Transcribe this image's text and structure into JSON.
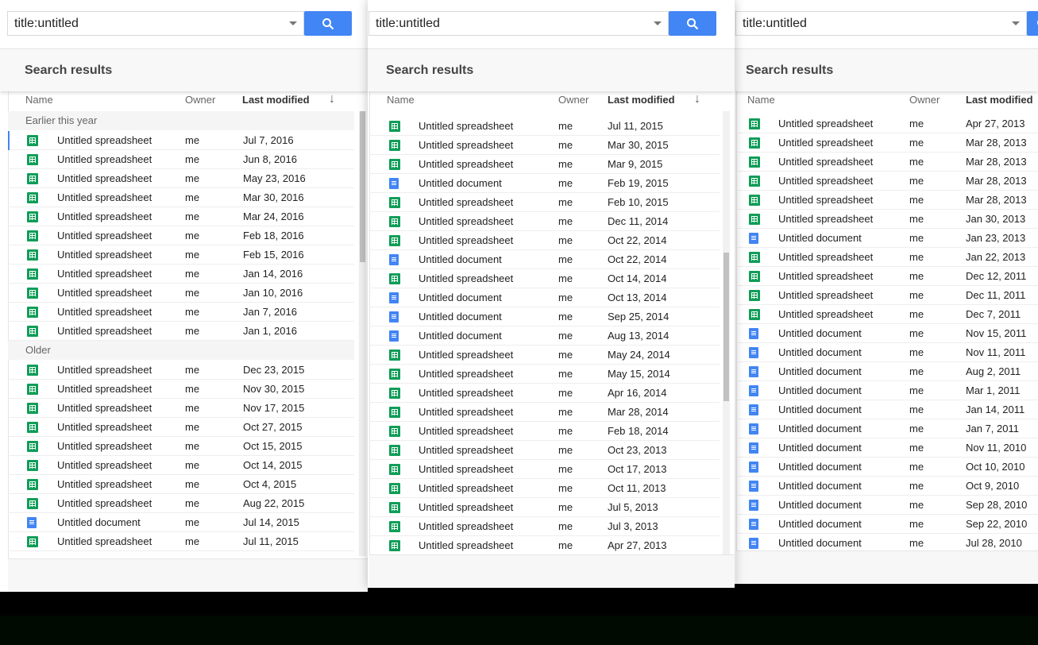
{
  "search": {
    "query": "title:untitled"
  },
  "header": {
    "title": "Search results"
  },
  "columns": {
    "name": "Name",
    "owner": "Owner",
    "modified": "Last modified",
    "sort_icon": "arrow-down-icon"
  },
  "colors": {
    "accent": "#4285f4",
    "sheet": "#0f9d58",
    "doc": "#4285f4"
  },
  "panels": [
    {
      "groups": [
        {
          "label": "Earlier this year",
          "rows": [
            {
              "t": "s",
              "name": "Untitled spreadsheet",
              "owner": "me",
              "date": "Jul 7, 2016"
            },
            {
              "t": "s",
              "name": "Untitled spreadsheet",
              "owner": "me",
              "date": "Jun 8, 2016"
            },
            {
              "t": "s",
              "name": "Untitled spreadsheet",
              "owner": "me",
              "date": "May 23, 2016"
            },
            {
              "t": "s",
              "name": "Untitled spreadsheet",
              "owner": "me",
              "date": "Mar 30, 2016"
            },
            {
              "t": "s",
              "name": "Untitled spreadsheet",
              "owner": "me",
              "date": "Mar 24, 2016"
            },
            {
              "t": "s",
              "name": "Untitled spreadsheet",
              "owner": "me",
              "date": "Feb 18, 2016"
            },
            {
              "t": "s",
              "name": "Untitled spreadsheet",
              "owner": "me",
              "date": "Feb 15, 2016"
            },
            {
              "t": "s",
              "name": "Untitled spreadsheet",
              "owner": "me",
              "date": "Jan 14, 2016"
            },
            {
              "t": "s",
              "name": "Untitled spreadsheet",
              "owner": "me",
              "date": "Jan 10, 2016"
            },
            {
              "t": "s",
              "name": "Untitled spreadsheet",
              "owner": "me",
              "date": "Jan 7, 2016"
            },
            {
              "t": "s",
              "name": "Untitled spreadsheet",
              "owner": "me",
              "date": "Jan 1, 2016"
            }
          ]
        },
        {
          "label": "Older",
          "rows": [
            {
              "t": "s",
              "name": "Untitled spreadsheet",
              "owner": "me",
              "date": "Dec 23, 2015"
            },
            {
              "t": "s",
              "name": "Untitled spreadsheet",
              "owner": "me",
              "date": "Nov 30, 2015"
            },
            {
              "t": "s",
              "name": "Untitled spreadsheet",
              "owner": "me",
              "date": "Nov 17, 2015"
            },
            {
              "t": "s",
              "name": "Untitled spreadsheet",
              "owner": "me",
              "date": "Oct 27, 2015"
            },
            {
              "t": "s",
              "name": "Untitled spreadsheet",
              "owner": "me",
              "date": "Oct 15, 2015"
            },
            {
              "t": "s",
              "name": "Untitled spreadsheet",
              "owner": "me",
              "date": "Oct 14, 2015"
            },
            {
              "t": "s",
              "name": "Untitled spreadsheet",
              "owner": "me",
              "date": "Oct 4, 2015"
            },
            {
              "t": "s",
              "name": "Untitled spreadsheet",
              "owner": "me",
              "date": "Aug 22, 2015"
            },
            {
              "t": "d",
              "name": "Untitled document",
              "owner": "me",
              "date": "Jul 14, 2015"
            },
            {
              "t": "s",
              "name": "Untitled spreadsheet",
              "owner": "me",
              "date": "Jul 11, 2015"
            }
          ]
        }
      ]
    },
    {
      "groups": [
        {
          "label": null,
          "rows": [
            {
              "t": "s",
              "name": "Untitled spreadsheet",
              "owner": "me",
              "date": "Jul 11, 2015"
            },
            {
              "t": "s",
              "name": "Untitled spreadsheet",
              "owner": "me",
              "date": "Mar 30, 2015"
            },
            {
              "t": "s",
              "name": "Untitled spreadsheet",
              "owner": "me",
              "date": "Mar 9, 2015"
            },
            {
              "t": "d",
              "name": "Untitled document",
              "owner": "me",
              "date": "Feb 19, 2015"
            },
            {
              "t": "s",
              "name": "Untitled spreadsheet",
              "owner": "me",
              "date": "Feb 10, 2015"
            },
            {
              "t": "s",
              "name": "Untitled spreadsheet",
              "owner": "me",
              "date": "Dec 11, 2014"
            },
            {
              "t": "s",
              "name": "Untitled spreadsheet",
              "owner": "me",
              "date": "Oct 22, 2014"
            },
            {
              "t": "d",
              "name": "Untitled document",
              "owner": "me",
              "date": "Oct 22, 2014"
            },
            {
              "t": "s",
              "name": "Untitled spreadsheet",
              "owner": "me",
              "date": "Oct 14, 2014"
            },
            {
              "t": "d",
              "name": "Untitled document",
              "owner": "me",
              "date": "Oct 13, 2014"
            },
            {
              "t": "d",
              "name": "Untitled document",
              "owner": "me",
              "date": "Sep 25, 2014"
            },
            {
              "t": "d",
              "name": "Untitled document",
              "owner": "me",
              "date": "Aug 13, 2014"
            },
            {
              "t": "s",
              "name": "Untitled spreadsheet",
              "owner": "me",
              "date": "May 24, 2014"
            },
            {
              "t": "s",
              "name": "Untitled spreadsheet",
              "owner": "me",
              "date": "May 15, 2014"
            },
            {
              "t": "s",
              "name": "Untitled spreadsheet",
              "owner": "me",
              "date": "Apr 16, 2014"
            },
            {
              "t": "s",
              "name": "Untitled spreadsheet",
              "owner": "me",
              "date": "Mar 28, 2014"
            },
            {
              "t": "s",
              "name": "Untitled spreadsheet",
              "owner": "me",
              "date": "Feb 18, 2014"
            },
            {
              "t": "s",
              "name": "Untitled spreadsheet",
              "owner": "me",
              "date": "Oct 23, 2013"
            },
            {
              "t": "s",
              "name": "Untitled spreadsheet",
              "owner": "me",
              "date": "Oct 17, 2013"
            },
            {
              "t": "s",
              "name": "Untitled spreadsheet",
              "owner": "me",
              "date": "Oct 11, 2013"
            },
            {
              "t": "s",
              "name": "Untitled spreadsheet",
              "owner": "me",
              "date": "Jul 5, 2013"
            },
            {
              "t": "s",
              "name": "Untitled spreadsheet",
              "owner": "me",
              "date": "Jul 3, 2013"
            },
            {
              "t": "s",
              "name": "Untitled spreadsheet",
              "owner": "me",
              "date": "Apr 27, 2013"
            }
          ]
        }
      ]
    },
    {
      "groups": [
        {
          "label": null,
          "rows": [
            {
              "t": "s",
              "name": "Untitled spreadsheet",
              "owner": "me",
              "date": "Apr 27, 2013"
            },
            {
              "t": "s",
              "name": "Untitled spreadsheet",
              "owner": "me",
              "date": "Mar 28, 2013"
            },
            {
              "t": "s",
              "name": "Untitled spreadsheet",
              "owner": "me",
              "date": "Mar 28, 2013"
            },
            {
              "t": "s",
              "name": "Untitled spreadsheet",
              "owner": "me",
              "date": "Mar 28, 2013"
            },
            {
              "t": "s",
              "name": "Untitled spreadsheet",
              "owner": "me",
              "date": "Mar 28, 2013"
            },
            {
              "t": "s",
              "name": "Untitled spreadsheet",
              "owner": "me",
              "date": "Jan 30, 2013"
            },
            {
              "t": "d",
              "name": "Untitled document",
              "owner": "me",
              "date": "Jan 23, 2013"
            },
            {
              "t": "s",
              "name": "Untitled spreadsheet",
              "owner": "me",
              "date": "Jan 22, 2013"
            },
            {
              "t": "s",
              "name": "Untitled spreadsheet",
              "owner": "me",
              "date": "Dec 12, 2011"
            },
            {
              "t": "s",
              "name": "Untitled spreadsheet",
              "owner": "me",
              "date": "Dec 11, 2011"
            },
            {
              "t": "s",
              "name": "Untitled spreadsheet",
              "owner": "me",
              "date": "Dec 7, 2011"
            },
            {
              "t": "d",
              "name": "Untitled document",
              "owner": "me",
              "date": "Nov 15, 2011"
            },
            {
              "t": "d",
              "name": "Untitled document",
              "owner": "me",
              "date": "Nov 11, 2011"
            },
            {
              "t": "d",
              "name": "Untitled document",
              "owner": "me",
              "date": "Aug 2, 2011"
            },
            {
              "t": "d",
              "name": "Untitled document",
              "owner": "me",
              "date": "Mar 1, 2011"
            },
            {
              "t": "d",
              "name": "Untitled document",
              "owner": "me",
              "date": "Jan 14, 2011"
            },
            {
              "t": "d",
              "name": "Untitled document",
              "owner": "me",
              "date": "Jan 7, 2011"
            },
            {
              "t": "d",
              "name": "Untitled document",
              "owner": "me",
              "date": "Nov 11, 2010"
            },
            {
              "t": "d",
              "name": "Untitled document",
              "owner": "me",
              "date": "Oct 10, 2010"
            },
            {
              "t": "d",
              "name": "Untitled document",
              "owner": "me",
              "date": "Oct 9, 2010"
            },
            {
              "t": "d",
              "name": "Untitled document",
              "owner": "me",
              "date": "Sep 28, 2010"
            },
            {
              "t": "d",
              "name": "Untitled document",
              "owner": "me",
              "date": "Sep 22, 2010"
            },
            {
              "t": "d",
              "name": "Untitled document",
              "owner": "me",
              "date": "Jul 28, 2010"
            }
          ]
        }
      ]
    }
  ]
}
